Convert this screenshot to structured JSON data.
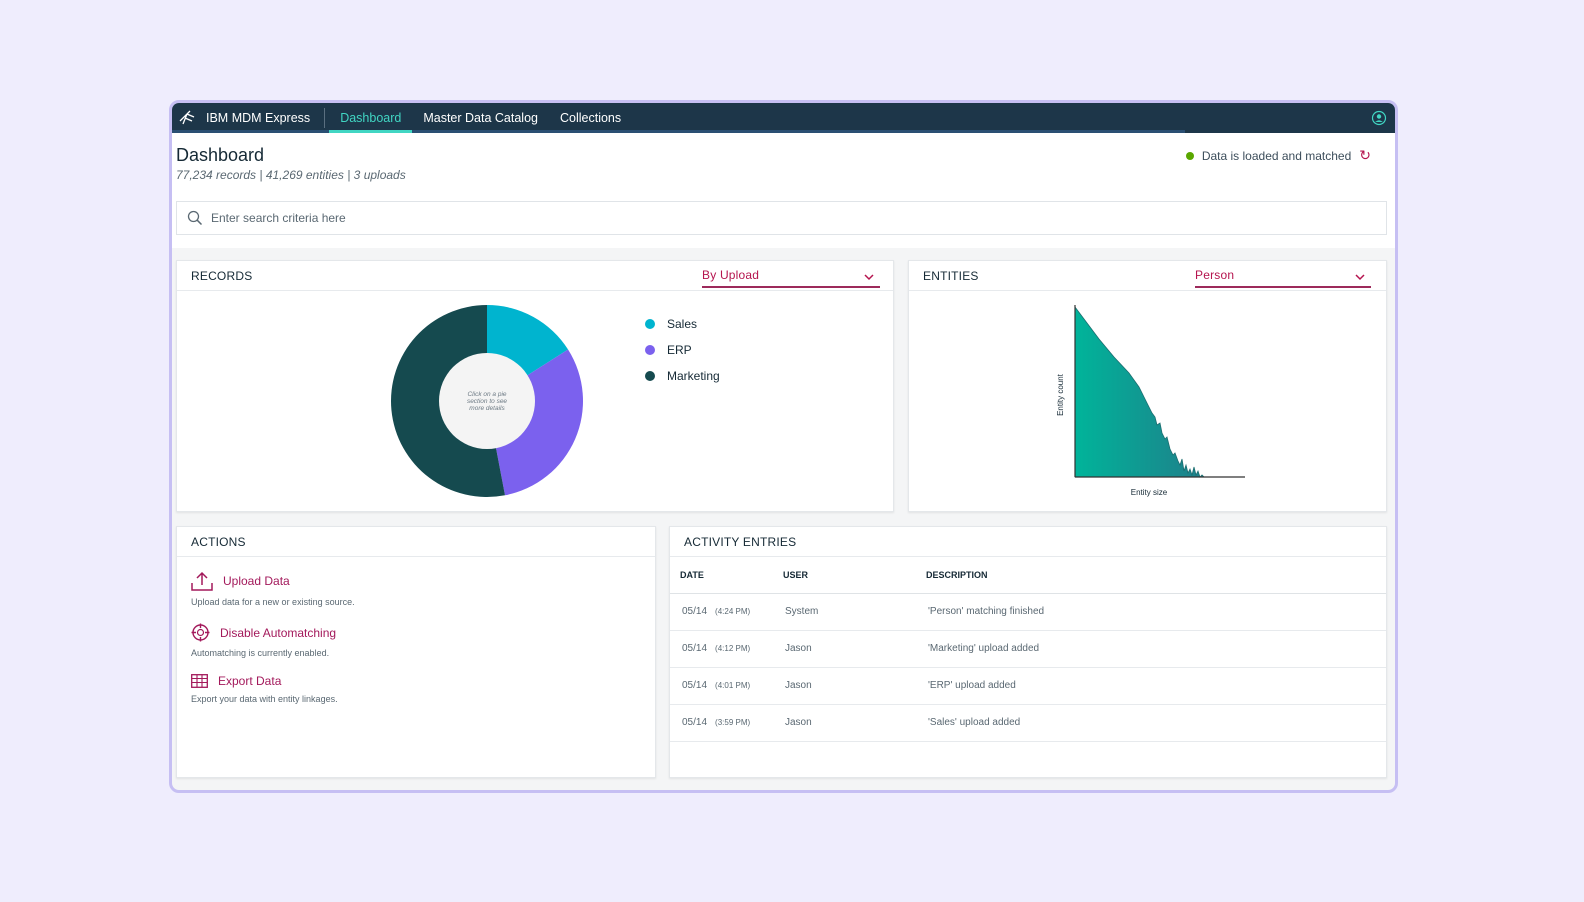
{
  "app": {
    "brand": "IBM MDM Express"
  },
  "nav": [
    {
      "label": "Dashboard",
      "active": true
    },
    {
      "label": "Master Data Catalog",
      "active": false
    },
    {
      "label": "Collections",
      "active": false
    }
  ],
  "header": {
    "title": "Dashboard",
    "subtitle": "77,234 records | 41,269 entities | 3 uploads",
    "status": "Data is loaded and matched"
  },
  "search": {
    "placeholder": "Enter search criteria here"
  },
  "records": {
    "title": "RECORDS",
    "dropdown": "By Upload",
    "center_text": [
      "Click on a pie",
      "section to see",
      "more details"
    ],
    "legend": [
      {
        "label": "Sales",
        "color": "#00b4cf"
      },
      {
        "label": "ERP",
        "color": "#7b61ee"
      },
      {
        "label": "Marketing",
        "color": "#154a4f"
      }
    ]
  },
  "entities": {
    "title": "ENTITIES",
    "dropdown": "Person",
    "y_label": "Entity count",
    "x_label": "Entity size"
  },
  "chart_data": {
    "type": "pie",
    "categories": [
      "Sales",
      "ERP",
      "Marketing"
    ],
    "values": [
      16,
      31,
      53
    ],
    "colors": [
      "#00b4cf",
      "#7b61ee",
      "#154a4f"
    ],
    "donut": true
  },
  "actions": {
    "title": "ACTIONS",
    "items": [
      {
        "label": "Upload Data",
        "desc": "Upload data for a new or existing source.",
        "icon": "upload-icon"
      },
      {
        "label": "Disable Automatching",
        "desc": "Automatching is currently enabled.",
        "icon": "crosshair-icon"
      },
      {
        "label": "Export Data",
        "desc": "Export your data with entity linkages.",
        "icon": "table-icon"
      }
    ]
  },
  "activity": {
    "title": "ACTIVITY ENTRIES",
    "columns": [
      "DATE",
      "USER",
      "DESCRIPTION"
    ],
    "rows": [
      {
        "date": "05/14",
        "time": "(4:24 PM)",
        "user": "System",
        "desc": "'Person' matching finished"
      },
      {
        "date": "05/14",
        "time": "(4:12 PM)",
        "user": "Jason",
        "desc": "'Marketing' upload added"
      },
      {
        "date": "05/14",
        "time": "(4:01 PM)",
        "user": "Jason",
        "desc": "'ERP' upload added"
      },
      {
        "date": "05/14",
        "time": "(3:59 PM)",
        "user": "Jason",
        "desc": "'Sales' upload added"
      }
    ]
  }
}
